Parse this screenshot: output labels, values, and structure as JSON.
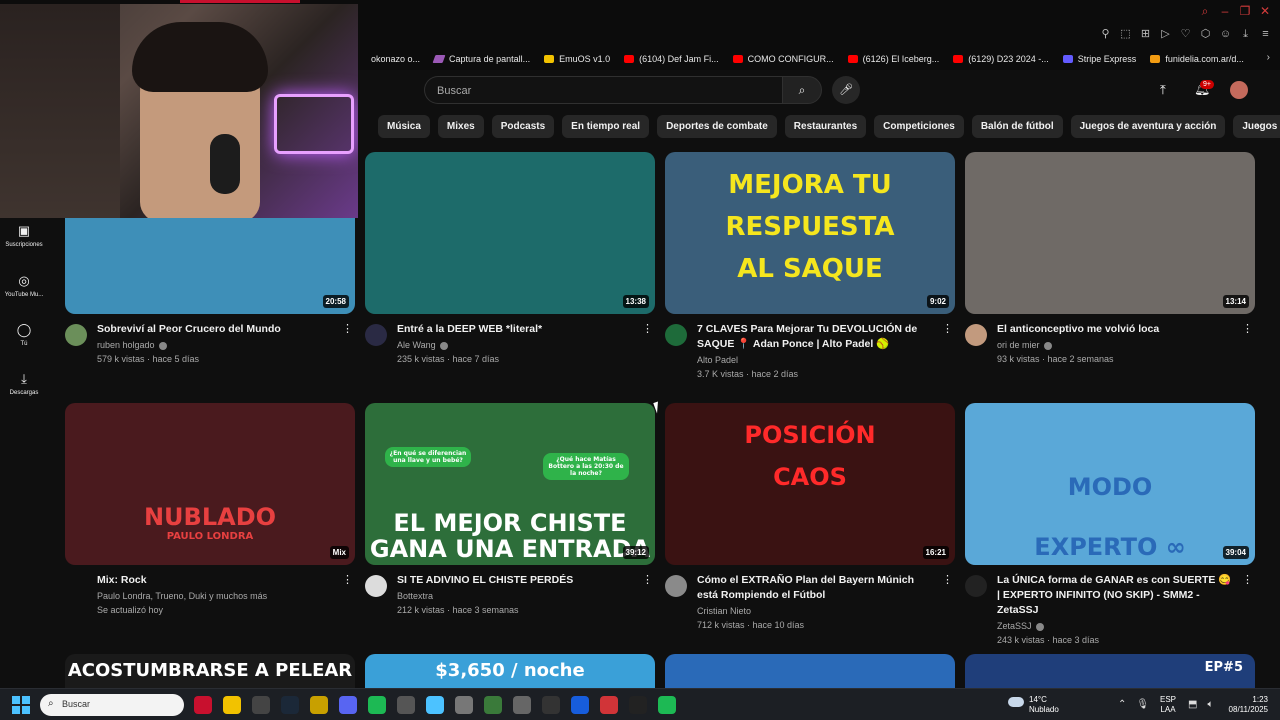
{
  "bookmarks": [
    {
      "label": "okonazo o...",
      "icon": "plain"
    },
    {
      "label": "Captura de pantall...",
      "icon": "pen"
    },
    {
      "label": "EmuOS v1.0",
      "icon": "crown"
    },
    {
      "label": "(6104) Def Jam Fi...",
      "icon": "youtube"
    },
    {
      "label": "COMO CONFIGUR...",
      "icon": "youtube"
    },
    {
      "label": "(6126) El Iceberg...",
      "icon": "youtube"
    },
    {
      "label": "(6129) D23 2024 -...",
      "icon": "youtube"
    },
    {
      "label": "Stripe Express",
      "icon": "stripe"
    },
    {
      "label": "funidelia.com.ar/d...",
      "icon": "fun"
    }
  ],
  "header": {
    "search_placeholder": "Buscar",
    "notification_count": "9+"
  },
  "chips": [
    "Música",
    "Mixes",
    "Podcasts",
    "En tiempo real",
    "Deportes de combate",
    "Restaurantes",
    "Competiciones",
    "Balón de fútbol",
    "Juegos de aventura y acción",
    "Juegos de estrategia e"
  ],
  "nav": [
    {
      "label": "Suscripciones",
      "icon": "subscriptions-icon"
    },
    {
      "label": "YouTube Mu...",
      "icon": "youtube-music-icon"
    },
    {
      "label": "Tú",
      "icon": "user-icon"
    },
    {
      "label": "Descargas",
      "icon": "download-icon"
    }
  ],
  "videos": [
    {
      "title": "Sobreviví al Peor Crucero del Mundo",
      "channel": "ruben holgado",
      "stats": "579 k vistas · hace 5 días",
      "duration": "20:58",
      "verified": true,
      "thumb_color": "#3e8fb8",
      "avatar_color": "#6b8f5a"
    },
    {
      "title": "Entré a la DEEP WEB *literal*",
      "channel": "Ale Wang",
      "stats": "235 k vistas · hace 7 días",
      "duration": "13:38",
      "verified": true,
      "thumb_color": "#1d6b6a",
      "avatar_color": "#2a2a44"
    },
    {
      "title": "7 CLAVES Para Mejorar Tu DEVOLUCIÓN de SAQUE 📍 Adan Ponce | Alto Padel 🥎",
      "channel": "Alto Padel",
      "stats": "3.7 K vistas · hace 2 días",
      "duration": "9:02",
      "verified": false,
      "thumb_color": "#3a5e7a",
      "avatar_color": "#1e6b3a",
      "thumb_lines": [
        "MEJORA TU",
        "RESPUESTA",
        "AL SAQUE"
      ]
    },
    {
      "title": "El anticonceptivo me volvió loca",
      "channel": "ori de mier",
      "stats": "93 k vistas · hace 2 semanas",
      "duration": "13:14",
      "verified": true,
      "thumb_color": "#6f6a66",
      "avatar_color": "#c29a7e"
    },
    {
      "title": "Mix: Rock",
      "channel": "Paulo Londra, Trueno, Duki y muchos más",
      "stats": "Se actualizó hoy",
      "duration": "Mix",
      "verified": false,
      "thumb_color": "#4a1a1e",
      "avatar_color": "",
      "thumb_lines": [
        "NUBLADO",
        "PAULO LONDRA"
      ]
    },
    {
      "title": "SI TE ADIVINO EL CHISTE PERDÉS",
      "channel": "Bottextra",
      "stats": "212 k vistas · hace 3 semanas",
      "duration": "39:12",
      "verified": false,
      "thumb_color": "#2d6e3a",
      "avatar_color": "#dcdcdc",
      "thumb_lines": [
        "EL MEJOR CHISTE",
        "GANA UNA ENTRADA"
      ],
      "bubbles": [
        "¿En qué se diferencian una llave y un bebé?",
        "¿Qué hace Matías Bottero a las 20:30 de la noche?"
      ]
    },
    {
      "title": "Cómo el EXTRAÑO Plan del Bayern Múnich está Rompiendo el Fútbol",
      "channel": "Cristian Nieto",
      "stats": "712 k vistas · hace 10 días",
      "duration": "16:21",
      "verified": false,
      "thumb_color": "#3a1212",
      "avatar_color": "#8a8a8a",
      "thumb_lines": [
        "POSICIÓN",
        "CAOS"
      ]
    },
    {
      "title": "La ÚNICA forma de GANAR es con SUERTE 😋 | EXPERTO INFINITO (NO SKIP) - SMM2 - ZetaSSJ",
      "channel": "ZetaSSJ",
      "stats": "243 k vistas · hace 3 días",
      "duration": "39:04",
      "verified": true,
      "thumb_color": "#5aa8d8",
      "avatar_color": "#222",
      "thumb_lines": [
        "MODO",
        "EXPERTO ∞"
      ]
    }
  ],
  "next_row_thumbs": [
    {
      "text": "ACOSTUMBRARSE A PELEAR",
      "color": "#1a1a1a"
    },
    {
      "text": "$3,650 / noche",
      "color": "#3aa0d8"
    },
    {
      "text": "",
      "color": "#2a6ab8"
    },
    {
      "text": "EP#5",
      "color": "#1f3e7a"
    }
  ],
  "taskbar": {
    "search_placeholder": "Buscar",
    "weather_temp": "14°C",
    "weather_desc": "Nublado",
    "lang_top": "ESP",
    "lang_bottom": "LAA",
    "time": "1:23",
    "date": "08/11/2025",
    "apps": [
      {
        "name": "opera-gx-icon",
        "color": "#c8102e"
      },
      {
        "name": "file-explorer-icon",
        "color": "#f2c200"
      },
      {
        "name": "chatgpt-icon",
        "color": "#444"
      },
      {
        "name": "steam-icon",
        "color": "#1b2838"
      },
      {
        "name": "app-icon",
        "color": "#c8a000"
      },
      {
        "name": "discord-icon",
        "color": "#5865f2"
      },
      {
        "name": "spotify-icon",
        "color": "#1db954"
      },
      {
        "name": "app2-icon",
        "color": "#555"
      },
      {
        "name": "notepad-icon",
        "color": "#4cc2ff"
      },
      {
        "name": "app3-icon",
        "color": "#777"
      },
      {
        "name": "app4-icon",
        "color": "#3a7a3a"
      },
      {
        "name": "app5-icon",
        "color": "#666"
      },
      {
        "name": "app6-icon",
        "color": "#333"
      },
      {
        "name": "bitwarden-icon",
        "color": "#175ddc"
      },
      {
        "name": "app7-icon",
        "color": "#d13438"
      },
      {
        "name": "app8-icon",
        "color": "#222"
      },
      {
        "name": "spotify2-icon",
        "color": "#1db954"
      }
    ]
  }
}
